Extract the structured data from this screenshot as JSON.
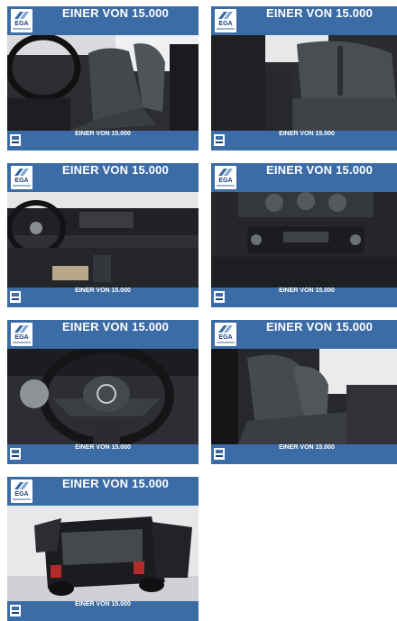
{
  "gallery": {
    "items": [
      {
        "title": "EINER VON 15.000",
        "logo": "EGA",
        "footer": "EINER VON 15.000",
        "photo": "front-seats-interior"
      },
      {
        "title": "EINER VON 15.000",
        "logo": "EGA",
        "footer": "EINER VON 15.000",
        "photo": "rear-seats-interior"
      },
      {
        "title": "EINER VON 15.000",
        "logo": "EGA",
        "footer": "EINER VON 15.000",
        "photo": "dashboard-steering"
      },
      {
        "title": "EINER VON 15.000",
        "logo": "EGA",
        "footer": "EINER VON 15.000",
        "photo": "center-console-radio"
      },
      {
        "title": "EINER VON 15.000",
        "logo": "EGA",
        "footer": "EINER VON 15.000",
        "photo": "steering-wheel-closeup"
      },
      {
        "title": "EINER VON 15.000",
        "logo": "EGA",
        "footer": "EINER VON 15.000",
        "photo": "driver-seat-side"
      },
      {
        "title": "EINER VON 15.000",
        "logo": "EGA",
        "footer": "EINER VON 15.000",
        "photo": "rear-open-trunk"
      }
    ]
  }
}
